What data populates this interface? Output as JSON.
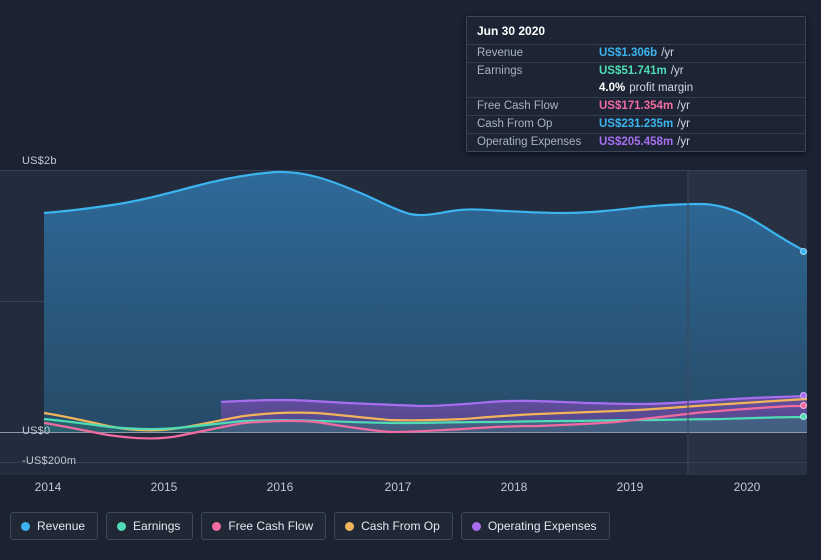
{
  "chart_data": {
    "type": "area",
    "title": "",
    "xlabel": "",
    "ylabel": "",
    "x": [
      "2014",
      "2015",
      "2016",
      "2017",
      "2018",
      "2019",
      "2020"
    ],
    "xticklabels": [
      "2014",
      "2015",
      "2016",
      "2017",
      "2018",
      "2019",
      "2020"
    ],
    "yticklabels": [
      "US$2b",
      "US$0",
      "-US$200m"
    ],
    "ylim": [
      -200000000,
      2000000000
    ],
    "grid": true,
    "legend_position": "bottom-left",
    "series": [
      {
        "name": "Revenue",
        "color": "#3cb4f0",
        "values": [
          1520,
          1540,
          1640,
          1780,
          1840,
          1790,
          1700,
          1690,
          1710,
          1720,
          1700,
          1690,
          1710,
          1740,
          1750,
          1760,
          1750,
          1700,
          1560,
          1420,
          1306
        ],
        "unit": "US$m"
      },
      {
        "name": "Earnings",
        "color": "#4fdcb4",
        "values": [
          70,
          55,
          30,
          10,
          5,
          20,
          40,
          55,
          60,
          55,
          45,
          40,
          42,
          45,
          48,
          50,
          52,
          55,
          58,
          55,
          51.741
        ],
        "unit": "US$m"
      },
      {
        "name": "Free Cash Flow",
        "color": "#f06ba0",
        "values": [
          40,
          10,
          -40,
          -90,
          -110,
          -80,
          -30,
          10,
          30,
          20,
          -20,
          -40,
          -20,
          0,
          20,
          30,
          40,
          60,
          90,
          130,
          171.354
        ],
        "unit": "US$m"
      },
      {
        "name": "Cash From Op",
        "color": "#f0b45a",
        "values": [
          90,
          60,
          20,
          -20,
          -30,
          10,
          60,
          100,
          120,
          110,
          80,
          60,
          80,
          100,
          110,
          120,
          130,
          150,
          180,
          210,
          231.235
        ],
        "unit": "US$m"
      },
      {
        "name": "Operating Expenses",
        "color": "#a96ef0",
        "values": [
          null,
          null,
          null,
          null,
          null,
          null,
          170,
          180,
          185,
          180,
          172,
          170,
          175,
          185,
          190,
          188,
          182,
          180,
          190,
          200,
          205.458
        ],
        "unit": "US$m"
      }
    ]
  },
  "tooltip": {
    "title": "Jun 30 2020",
    "rows": [
      {
        "label": "Revenue",
        "value": "US$1.306b",
        "unit": "/yr",
        "color": "#3cb4f0",
        "sub": ""
      },
      {
        "label": "Earnings",
        "value": "US$51.741m",
        "unit": "/yr",
        "color": "#4fdcb4",
        "sub": ""
      },
      {
        "label": "",
        "value": "4.0%",
        "unit": "",
        "color": "#ffffff",
        "sub": "profit margin"
      },
      {
        "label": "Free Cash Flow",
        "value": "US$171.354m",
        "unit": "/yr",
        "color": "#f06ba0",
        "sub": ""
      },
      {
        "label": "Cash From Op",
        "value": "US$231.235m",
        "unit": "/yr",
        "color": "#3cb4f0",
        "sub": ""
      },
      {
        "label": "Operating Expenses",
        "value": "US$205.458m",
        "unit": "/yr",
        "color": "#a96ef0",
        "sub": ""
      }
    ]
  },
  "axis": {
    "y_top": "US$2b",
    "y_zero": "US$0",
    "y_bottom": "-US$200m",
    "x": [
      "2014",
      "2015",
      "2016",
      "2017",
      "2018",
      "2019",
      "2020"
    ]
  },
  "legend": [
    {
      "label": "Revenue",
      "color": "#3cb4f0"
    },
    {
      "label": "Earnings",
      "color": "#4fdcb4"
    },
    {
      "label": "Free Cash Flow",
      "color": "#f06ba0"
    },
    {
      "label": "Cash From Op",
      "color": "#f0b45a"
    },
    {
      "label": "Operating Expenses",
      "color": "#a96ef0"
    }
  ]
}
